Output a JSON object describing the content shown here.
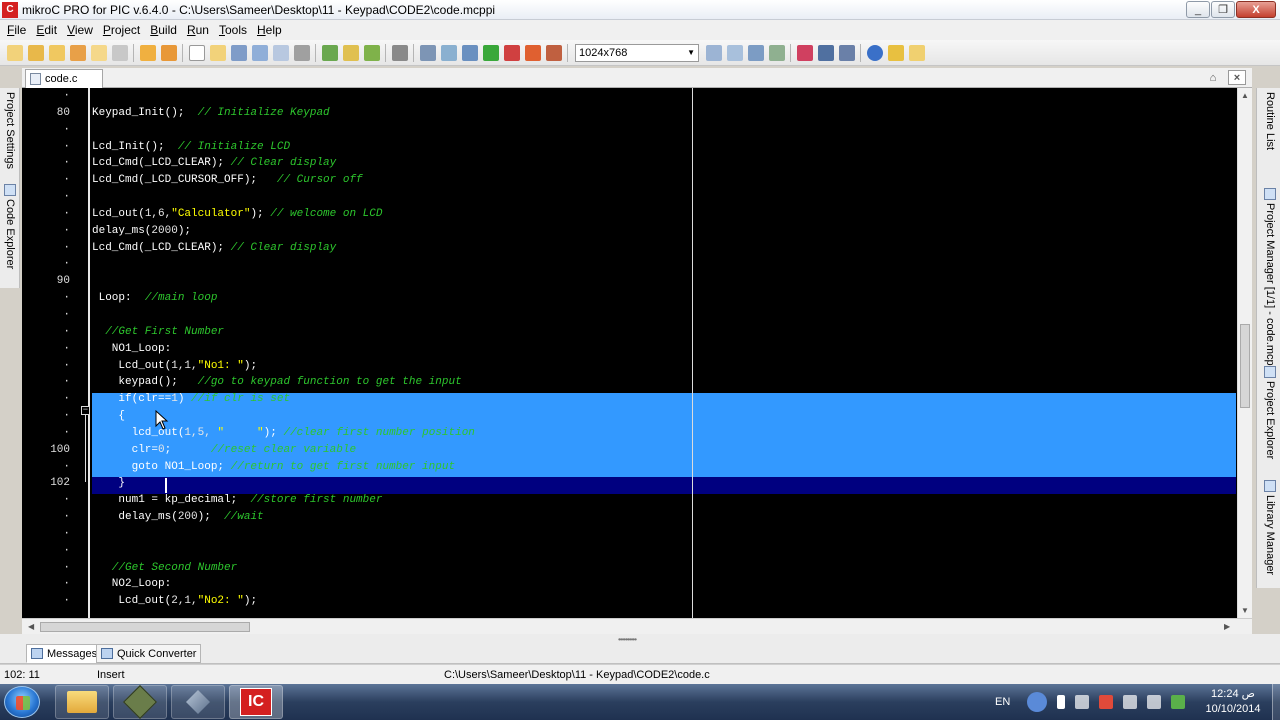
{
  "window": {
    "title": "mikroC PRO for PIC v.6.4.0 - C:\\Users\\Sameer\\Desktop\\11 - Keypad\\CODE2\\code.mcppi",
    "controls": [
      "_",
      "❐",
      "X"
    ]
  },
  "menu": [
    {
      "label": "File",
      "underline": "F",
      "rest": "ile"
    },
    {
      "label": "Edit",
      "underline": "E",
      "rest": "dit"
    },
    {
      "label": "View",
      "underline": "V",
      "rest": "iew"
    },
    {
      "label": "Project",
      "underline": "P",
      "rest": "roject"
    },
    {
      "label": "Build",
      "underline": "B",
      "rest": "uild"
    },
    {
      "label": "Run",
      "underline": "R",
      "rest": "un"
    },
    {
      "label": "Tools",
      "underline": "T",
      "rest": "ools"
    },
    {
      "label": "Help",
      "underline": "H",
      "rest": "elp"
    }
  ],
  "toolbar": {
    "resolution": "1024x768"
  },
  "tab": {
    "label": "code.c"
  },
  "left_panels": [
    "Project Settings",
    "Code Explorer"
  ],
  "right_panels": [
    "Routine List",
    "Project Manager [1/1] - code.mcppi",
    "Project Explorer",
    "Library Manager"
  ],
  "editor": {
    "lines": [
      {
        "ln": "·",
        "code": []
      },
      {
        "ln": "80",
        "code": [
          [
            "code",
            "Keypad_Init();  "
          ],
          [
            "com",
            "// Initialize Keypad"
          ]
        ]
      },
      {
        "ln": "·",
        "code": []
      },
      {
        "ln": "·",
        "code": [
          [
            "code",
            "Lcd_Init();  "
          ],
          [
            "com",
            "// Initialize LCD"
          ]
        ]
      },
      {
        "ln": "·",
        "code": [
          [
            "code",
            "Lcd_Cmd(_LCD_CLEAR); "
          ],
          [
            "com",
            "// Clear display"
          ]
        ]
      },
      {
        "ln": "·",
        "code": [
          [
            "code",
            "Lcd_Cmd(_LCD_CURSOR_OFF);   "
          ],
          [
            "com",
            "// Cursor off"
          ]
        ]
      },
      {
        "ln": "·",
        "code": []
      },
      {
        "ln": "·",
        "code": [
          [
            "code",
            "Lcd_out("
          ],
          [
            "num",
            "1,6,"
          ],
          [
            "str",
            "\"Calculator\""
          ],
          [
            "code",
            "); "
          ],
          [
            "com",
            "// welcome on LCD"
          ]
        ]
      },
      {
        "ln": "·",
        "code": [
          [
            "code",
            "delay_ms("
          ],
          [
            "num",
            "2000"
          ],
          [
            "code",
            ");"
          ]
        ]
      },
      {
        "ln": "·",
        "code": [
          [
            "code",
            "Lcd_Cmd(_LCD_CLEAR); "
          ],
          [
            "com",
            "// Clear display"
          ]
        ]
      },
      {
        "ln": "·",
        "code": []
      },
      {
        "ln": "90",
        "code": []
      },
      {
        "ln": "·",
        "code": [
          [
            "code",
            " Loop:  "
          ],
          [
            "com",
            "//main loop"
          ]
        ]
      },
      {
        "ln": "·",
        "code": []
      },
      {
        "ln": "·",
        "code": [
          [
            "com",
            "  //Get First Number"
          ]
        ]
      },
      {
        "ln": "·",
        "code": [
          [
            "code",
            "   NO1_Loop:"
          ]
        ]
      },
      {
        "ln": "·",
        "code": [
          [
            "code",
            "    Lcd_out("
          ],
          [
            "num",
            "1,1,"
          ],
          [
            "str",
            "\"No1: \""
          ],
          [
            "code",
            ");"
          ]
        ]
      },
      {
        "ln": "·",
        "code": [
          [
            "code",
            "    keypad();   "
          ],
          [
            "com",
            "//go to keypad function to get the input"
          ]
        ]
      },
      {
        "ln": "·",
        "code": [
          [
            "code",
            "    if(clr=="
          ],
          [
            "num",
            "1"
          ],
          [
            "code",
            ") "
          ],
          [
            "com",
            "//if clr is set"
          ]
        ]
      },
      {
        "ln": "·",
        "code": [
          [
            "code",
            "    {"
          ]
        ]
      },
      {
        "ln": "·",
        "code": [
          [
            "code",
            "      lcd_out("
          ],
          [
            "num",
            "1,5, "
          ],
          [
            "str",
            "\"     \""
          ],
          [
            "code",
            "); "
          ],
          [
            "com",
            "//clear first number position"
          ]
        ]
      },
      {
        "ln": "100",
        "code": [
          [
            "code",
            "      clr="
          ],
          [
            "num",
            "0"
          ],
          [
            "code",
            ";      "
          ],
          [
            "com",
            "//reset clear variable"
          ]
        ]
      },
      {
        "ln": "·",
        "code": [
          [
            "code",
            "      goto NO1_Loop; "
          ],
          [
            "com",
            "//return to get first number input"
          ]
        ]
      },
      {
        "ln": "102",
        "code": [
          [
            "code",
            "    }"
          ]
        ]
      },
      {
        "ln": "·",
        "code": [
          [
            "code",
            "    num1 = kp_decimal;  "
          ],
          [
            "com",
            "//store first number"
          ]
        ]
      },
      {
        "ln": "·",
        "code": [
          [
            "code",
            "    delay_ms("
          ],
          [
            "num",
            "200"
          ],
          [
            "code",
            ");  "
          ],
          [
            "com",
            "//wait"
          ]
        ]
      },
      {
        "ln": "·",
        "code": []
      },
      {
        "ln": "·",
        "code": []
      },
      {
        "ln": "·",
        "code": [
          [
            "com",
            "   //Get Second Number"
          ]
        ]
      },
      {
        "ln": "·",
        "code": [
          [
            "code",
            "   NO2_Loop:"
          ]
        ]
      },
      {
        "ln": "·",
        "code": [
          [
            "code",
            "    Lcd_out("
          ],
          [
            "num",
            "2,1,"
          ],
          [
            "str",
            "\"No2: \""
          ],
          [
            "code",
            ");"
          ]
        ]
      }
    ]
  },
  "bottom_tabs": [
    "Messages",
    "Quick Converter"
  ],
  "status": {
    "position": "102: 11",
    "mode": "Insert",
    "path": "C:\\Users\\Sameer\\Desktop\\11 - Keypad\\CODE2\\code.c"
  },
  "taskbar": {
    "language": "EN",
    "time": "12:24 ص",
    "date": "10/10/2014"
  },
  "colors": {
    "selection": "#3399ff",
    "caret_row": "#000080",
    "comment": "#2dc62d",
    "string": "#ffff00"
  }
}
